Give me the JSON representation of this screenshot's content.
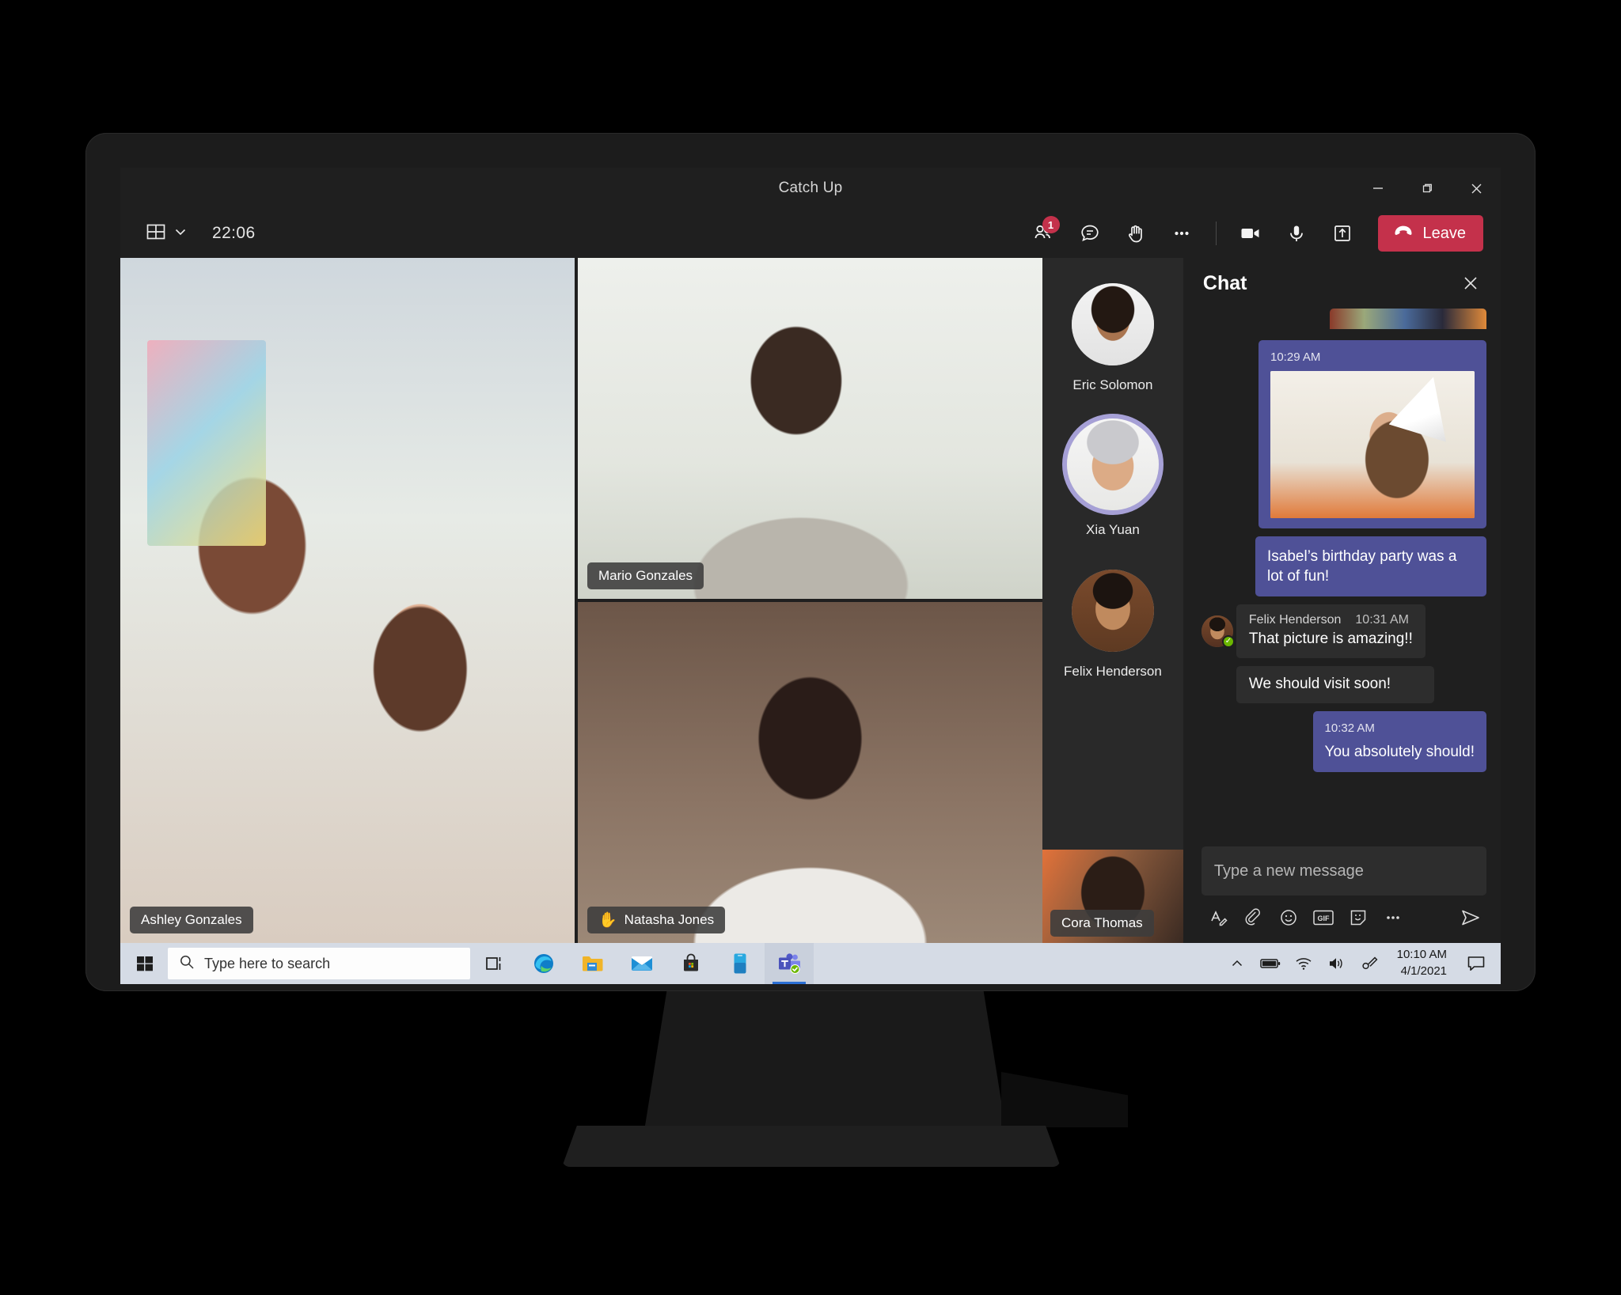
{
  "window": {
    "title": "Catch Up",
    "minimize_label": "Minimize",
    "restore_label": "Restore",
    "close_label": "Close"
  },
  "toolbar": {
    "layout_icon": "grid-layout-icon",
    "layout_chevron": "chevron-down-icon",
    "call_timer": "22:06",
    "participants_icon": "people-icon",
    "participants_badge": "1",
    "chat_icon": "chat-bubble-icon",
    "raise_hand_icon": "raised-hand-icon",
    "more_icon": "more-options-icon",
    "camera_icon": "video-camera-icon",
    "mic_icon": "microphone-icon",
    "share_icon": "share-screen-icon",
    "leave_label": "Leave",
    "leave_color": "#c4314b"
  },
  "video_tiles": [
    {
      "name": "Ashley Gonzales",
      "hand_raised": false,
      "active_speaker": false
    },
    {
      "name": "Mario Gonzales",
      "hand_raised": false,
      "active_speaker": false
    },
    {
      "name": "Natasha Jones",
      "hand_raised": true,
      "hand_icon": "raised-hand-emoji",
      "active_speaker": true,
      "active_border_color": "#e8a33d"
    }
  ],
  "roster": {
    "items": [
      {
        "name": "Eric Solomon",
        "speaking": false
      },
      {
        "name": "Xia Yuan",
        "speaking": true,
        "ring_color": "#a6a0d6"
      },
      {
        "name": "Felix Henderson",
        "speaking": false
      }
    ],
    "video_tile": {
      "name": "Cora Thomas"
    }
  },
  "chat": {
    "title": "Chat",
    "close_icon": "close-icon",
    "messages": [
      {
        "direction": "outgoing",
        "timestamp": "10:29 AM",
        "has_image": true,
        "image_alt": "girl-blowing-party-horn",
        "text": ""
      },
      {
        "direction": "outgoing",
        "timestamp": "",
        "has_image": false,
        "text": "Isabel’s birthday party was a lot of fun!"
      },
      {
        "direction": "incoming",
        "sender": "Felix Henderson",
        "timestamp": "10:31 AM",
        "presence": "available",
        "text": "That picture is amazing!!"
      },
      {
        "direction": "incoming",
        "sender": "",
        "timestamp": "",
        "text": "We should visit soon!"
      },
      {
        "direction": "outgoing",
        "timestamp": "10:32 AM",
        "has_image": false,
        "text": "You absolutely should!"
      }
    ],
    "composer": {
      "placeholder": "Type a new message",
      "value": "",
      "tools": [
        {
          "icon": "format-text-icon",
          "label": "Format"
        },
        {
          "icon": "paperclip-icon",
          "label": "Attach file"
        },
        {
          "icon": "emoji-icon",
          "label": "Emoji"
        },
        {
          "icon": "gif-icon",
          "label": "GIF"
        },
        {
          "icon": "sticker-icon",
          "label": "Sticker"
        },
        {
          "icon": "more-options-icon",
          "label": "More options"
        }
      ],
      "send_icon": "send-icon"
    },
    "bubble_outgoing_color": "#4f5197",
    "bubble_incoming_color": "#2d2d2d"
  },
  "taskbar": {
    "start_icon": "windows-start-icon",
    "search": {
      "icon": "search-icon",
      "placeholder": "Type here to search",
      "value": ""
    },
    "apps": [
      {
        "icon": "task-view-icon",
        "label": "Task View",
        "active": false
      },
      {
        "icon": "microsoft-edge-icon",
        "label": "Microsoft Edge",
        "active": false
      },
      {
        "icon": "file-explorer-icon",
        "label": "File Explorer",
        "active": false
      },
      {
        "icon": "mail-icon",
        "label": "Mail",
        "active": false
      },
      {
        "icon": "microsoft-store-icon",
        "label": "Microsoft Store",
        "active": false
      },
      {
        "icon": "your-phone-icon",
        "label": "Your Phone",
        "active": false
      },
      {
        "icon": "microsoft-teams-icon",
        "label": "Microsoft Teams",
        "active": true
      }
    ],
    "tray": [
      {
        "icon": "show-hidden-icons-chevron"
      },
      {
        "icon": "battery-icon"
      },
      {
        "icon": "wifi-icon"
      },
      {
        "icon": "volume-icon"
      },
      {
        "icon": "pen-menu-icon"
      }
    ],
    "clock": {
      "time": "10:10 AM",
      "date": "4/1/2021"
    },
    "action_center_icon": "action-center-icon"
  }
}
